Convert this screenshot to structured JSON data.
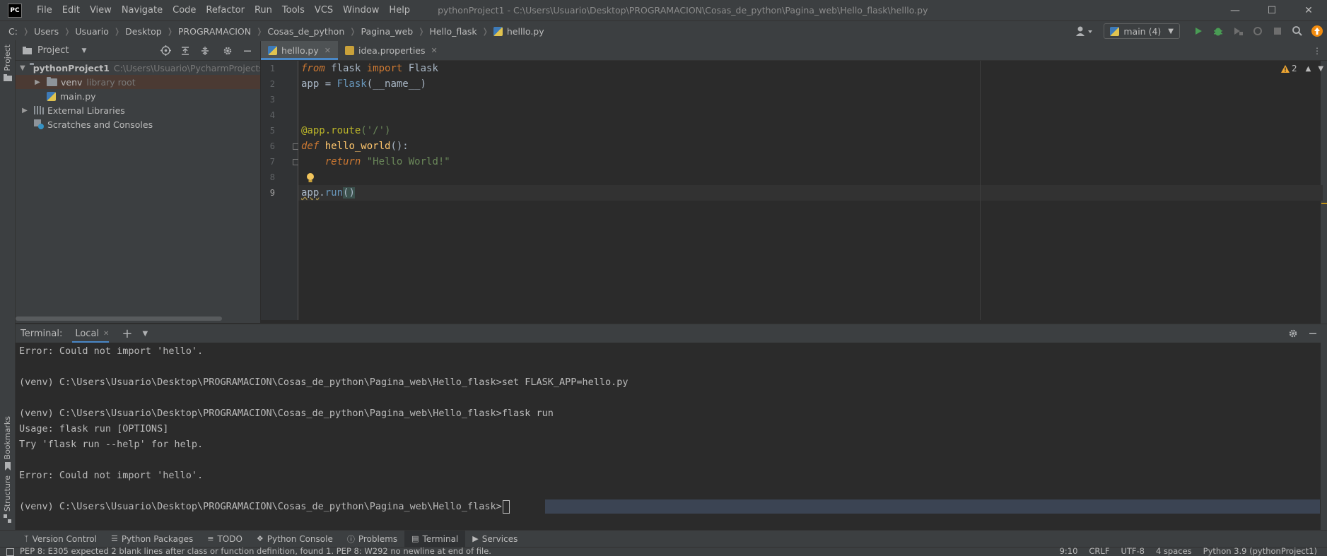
{
  "app": {
    "logo_text": "PC"
  },
  "menu": [
    "File",
    "Edit",
    "View",
    "Navigate",
    "Code",
    "Refactor",
    "Run",
    "Tools",
    "VCS",
    "Window",
    "Help"
  ],
  "window_title": "pythonProject1 - C:\\Users\\Usuario\\Desktop\\PROGRAMACION\\Cosas_de_python\\Pagina_web\\Hello_flask\\helllo.py",
  "breadcrumbs": [
    "C:",
    "Users",
    "Usuario",
    "Desktop",
    "PROGRAMACION",
    "Cosas_de_python",
    "Pagina_web",
    "Hello_flask",
    "helllo.py"
  ],
  "run_config": "main (4)",
  "left_stripe": {
    "project": "Project",
    "bookmarks": "Bookmarks",
    "structure": "Structure"
  },
  "project_panel": {
    "title": "Project",
    "root": {
      "name": "pythonProject1",
      "path": "C:\\Users\\Usuario\\PycharmProjects\\pyth"
    },
    "venv": {
      "name": "venv",
      "note": "library root"
    },
    "file": "main.py",
    "external": "External Libraries",
    "scratches": "Scratches and Consoles"
  },
  "editor": {
    "tabs": [
      {
        "label": "helllo.py"
      },
      {
        "label": "idea.properties"
      }
    ],
    "line_numbers": [
      "1",
      "2",
      "3",
      "4",
      "5",
      "6",
      "7",
      "8",
      "9"
    ],
    "tokens": {
      "from": "from",
      "flask": " flask ",
      "import": "import",
      "Flask": " Flask",
      "app_eq": "app = ",
      "Flask2": "Flask",
      "name": "(__name__)",
      "route_dec": "@app.route",
      "route_args": "('/')",
      "def": "def",
      "fn_name": " hello_world",
      "fn_tail": "():",
      "ret_indent": "    ",
      "return": "return",
      "ret_str": " \"Hello World!\"",
      "app_run_a": "app",
      "app_run_b": ".",
      "app_run_c": "run",
      "app_run_d": "()"
    },
    "warnings": "2",
    "colors": {
      "keyword": "#cc7832",
      "function": "#ffc66d",
      "decorator": "#bbb529",
      "string": "#6a8759",
      "class": "#6897bb"
    }
  },
  "terminal": {
    "label": "Terminal:",
    "tab": "Local",
    "lines": [
      "Error: Could not import 'hello'.",
      "",
      "(venv) C:\\Users\\Usuario\\Desktop\\PROGRAMACION\\Cosas_de_python\\Pagina_web\\Hello_flask>set FLASK_APP=hello.py",
      "",
      "(venv) C:\\Users\\Usuario\\Desktop\\PROGRAMACION\\Cosas_de_python\\Pagina_web\\Hello_flask>flask run",
      "Usage: flask run [OPTIONS]",
      "Try 'flask run --help' for help.",
      "",
      "Error: Could not import 'hello'.",
      "",
      "(venv) C:\\Users\\Usuario\\Desktop\\PROGRAMACION\\Cosas_de_python\\Pagina_web\\Hello_flask>"
    ]
  },
  "tool_windows": [
    "Version Control",
    "Python Packages",
    "TODO",
    "Python Console",
    "Problems",
    "Terminal",
    "Services"
  ],
  "status": {
    "message": "PEP 8: E305 expected 2 blank lines after class or function definition, found 1. PEP 8: W292 no newline at end of file.",
    "position": "9:10",
    "line_sep": "CRLF",
    "encoding": "UTF-8",
    "indent": "4 spaces",
    "interpreter": "Python 3.9 (pythonProject1)"
  }
}
